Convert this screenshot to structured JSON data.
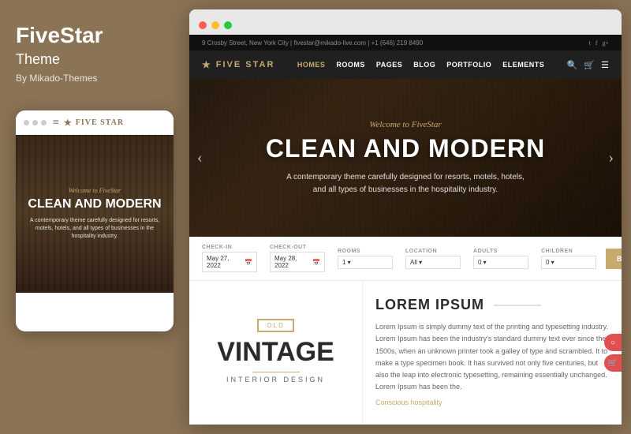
{
  "left": {
    "brand": "FiveStar",
    "theme_label": "Theme",
    "by_label": "By Mikado-Themes",
    "mobile_dots": [
      "",
      "",
      ""
    ],
    "mobile_nav_icon": "≡",
    "mobile_logo": "FIVE STAR",
    "mobile_welcome": "Welcome to FiveStar",
    "mobile_headline": "CLEAN AND MODERN",
    "mobile_desc": "A contemporary theme carefully designed for resorts, motels, hotels, and all types of businesses in the hospitality industry."
  },
  "browser": {
    "dots": [
      "red",
      "yellow",
      "green"
    ]
  },
  "site": {
    "nav_top_left": "9 Crosby Street, New York City  |  fivestar@mikado-live.com  |  +1 (646) 219 8490",
    "social_icons": [
      "t",
      "f",
      "g+"
    ],
    "logo": "FIVE STAR",
    "nav_links": [
      {
        "label": "HOMES",
        "active": true
      },
      {
        "label": "ROOMS",
        "active": false
      },
      {
        "label": "PAGES",
        "active": false
      },
      {
        "label": "BLOG",
        "active": false
      },
      {
        "label": "PORTFOLIO",
        "active": false
      },
      {
        "label": "ELEMENTS",
        "active": false
      }
    ],
    "hero": {
      "welcome": "Welcome to FiveStar",
      "headline": "CLEAN AND MODERN",
      "subtext_line1": "A contemporary theme carefully designed for resorts, motels, hotels,",
      "subtext_line2": "and all types of businesses in the hospitality industry."
    },
    "booking": {
      "fields": [
        {
          "label": "CHECK-IN",
          "value": "May 27, 2022",
          "type": "date"
        },
        {
          "label": "CHECK-OUT",
          "value": "May 28, 2022",
          "type": "date"
        },
        {
          "label": "ROOMS",
          "value": "1",
          "type": "select"
        },
        {
          "label": "LOCATION",
          "value": "All",
          "type": "select"
        },
        {
          "label": "ADULTS",
          "value": "0",
          "type": "select"
        },
        {
          "label": "CHILDREN",
          "value": "0",
          "type": "select"
        }
      ],
      "button_label": "BOOK NOW"
    },
    "lower": {
      "vintage_badge": "OLD",
      "vintage_title": "VINTAGE",
      "vintage_sub": "INTERIOR DESIGN",
      "lorem_title": "LOREM IPSUM",
      "lorem_body": "Lorem Ipsum is simply dummy text of the printing and typesetting industry. Lorem Ipsum has been the industry's standard dummy text ever since the 1500s, when an unknown printer took a galley of type and scrambled. It to make a type specimen book. It has survived not only five centuries, but also the leap into electronic typesetting, remaining essentially unchanged. Lorem Ipsum has been the.",
      "lorem_link": "Conscious hospitality"
    }
  }
}
